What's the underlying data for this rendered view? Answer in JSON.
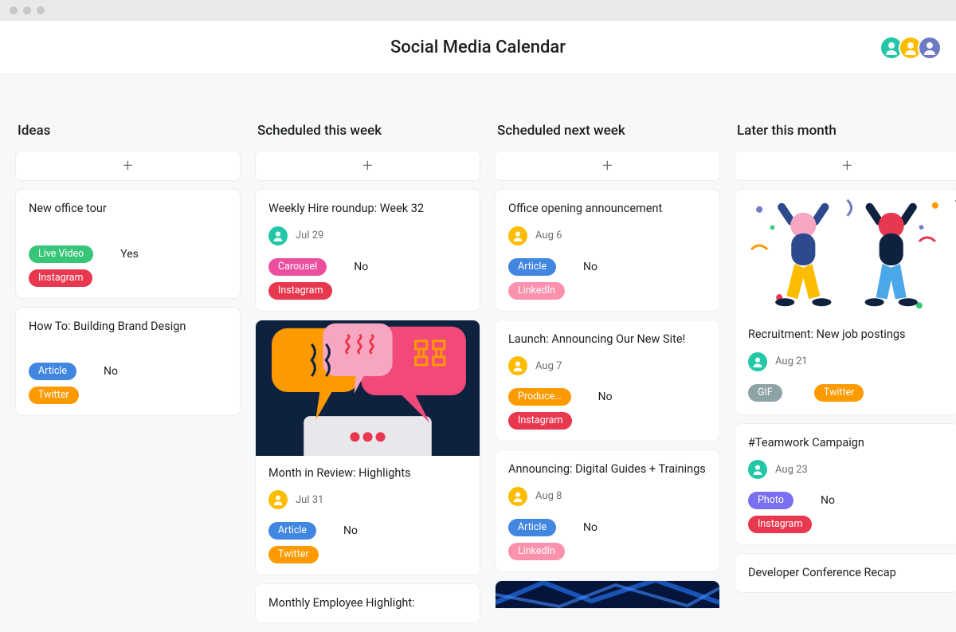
{
  "window": {
    "title": "Social Media Calendar"
  },
  "avatars": [
    {
      "color": "av-teal"
    },
    {
      "color": "av-gold"
    },
    {
      "color": "av-ind"
    }
  ],
  "columns": [
    {
      "title": "Ideas",
      "cards": [
        {
          "title": "New office tour",
          "tags": [
            {
              "label": "Live Video",
              "cls": "t-green"
            },
            {
              "label": "Instagram",
              "cls": "t-crimson"
            }
          ],
          "flag": "Yes"
        },
        {
          "title": "How To: Building Brand Design",
          "tags": [
            {
              "label": "Article",
              "cls": "t-blue"
            },
            {
              "label": "Twitter",
              "cls": "t-orange"
            }
          ],
          "flag": "No"
        }
      ]
    },
    {
      "title": "Scheduled this week",
      "cards": [
        {
          "title": "Weekly Hire roundup: Week 32",
          "avatar": "av-teal",
          "date": "Jul 29",
          "tags": [
            {
              "label": "Carousel",
              "cls": "t-hotpink"
            },
            {
              "label": "Instagram",
              "cls": "t-crimson"
            }
          ],
          "flag": "No"
        },
        {
          "cover": "speech",
          "title": "Month in Review: Highlights",
          "avatar": "av-gold",
          "date": "Jul 31",
          "tags": [
            {
              "label": "Article",
              "cls": "t-blue"
            },
            {
              "label": "Twitter",
              "cls": "t-orange"
            }
          ],
          "flag": "No"
        },
        {
          "title": "Monthly Employee Highlight:"
        }
      ]
    },
    {
      "title": "Scheduled next week",
      "cards": [
        {
          "title": "Office opening announcement",
          "avatar": "av-gold",
          "date": "Aug 6",
          "tags": [
            {
              "label": "Article",
              "cls": "t-blue"
            },
            {
              "label": "LinkedIn",
              "cls": "t-lightpink"
            }
          ],
          "flag": "No"
        },
        {
          "title": "Launch: Announcing Our New Site!",
          "avatar": "av-gold",
          "date": "Aug 7",
          "tags": [
            {
              "label": "Produce…",
              "cls": "t-orange"
            },
            {
              "label": "Instagram",
              "cls": "t-crimson"
            }
          ],
          "flag": "No"
        },
        {
          "title": "Announcing: Digital Guides + Trainings",
          "avatar": "av-gold",
          "date": "Aug 8",
          "tags": [
            {
              "label": "Article",
              "cls": "t-blue"
            },
            {
              "label": "LinkedIn",
              "cls": "t-lightpink"
            }
          ],
          "flag": "No"
        },
        {
          "cover": "tech"
        }
      ]
    },
    {
      "title": "Later this month",
      "cards": [
        {
          "cover": "party",
          "title": "Recruitment: New job postings",
          "avatar": "av-teal",
          "date": "Aug 21",
          "more": true,
          "tags": [
            {
              "label": "GIF",
              "cls": "t-gray"
            },
            {
              "label": "Twitter",
              "cls": "t-orange"
            }
          ],
          "split_tags": true
        },
        {
          "title": "#Teamwork Campaign",
          "avatar": "av-teal",
          "date": "Aug 23",
          "tags": [
            {
              "label": "Photo",
              "cls": "t-purple"
            },
            {
              "label": "Instagram",
              "cls": "t-crimson"
            }
          ],
          "flag": "No"
        },
        {
          "title": "Developer Conference Recap"
        }
      ]
    }
  ]
}
